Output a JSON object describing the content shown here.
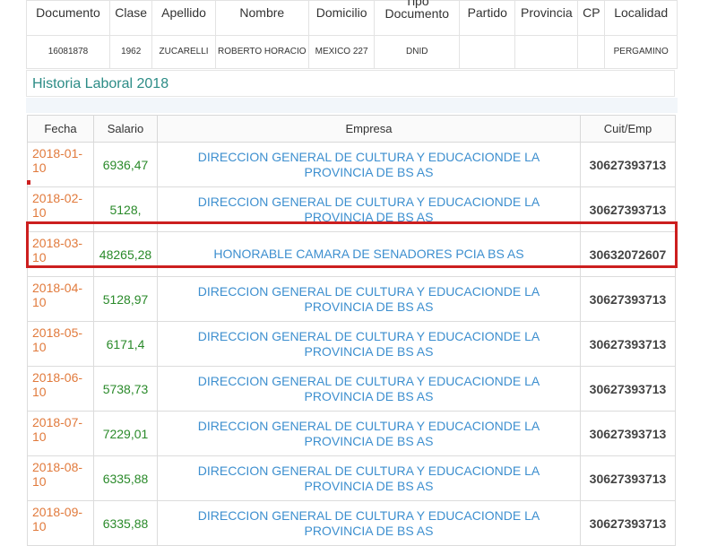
{
  "person_table": {
    "headers": [
      "Documento",
      "Clase",
      "Apellido",
      "Nombre",
      "Domicilio",
      "Tipo Documento",
      "Partido",
      "Provincia",
      "CP",
      "Localidad"
    ],
    "row": [
      "16081878",
      "1962",
      "ZUCARELLI",
      "ROBERTO HORACIO",
      "MEXICO 227",
      "DNID",
      "",
      "",
      "",
      "PERGAMINO"
    ]
  },
  "section": {
    "title": "Historia Laboral 2018"
  },
  "laboral_table": {
    "headers": {
      "fecha": "Fecha",
      "salario": "Salario",
      "empresa": "Empresa",
      "cuit": "Cuit/Emp"
    },
    "rows": [
      {
        "fecha": "2018-01-10",
        "salario": "6936,47",
        "empresa": "DIRECCION GENERAL DE CULTURA Y EDUCACIONDE LA PROVINCIA DE BS AS",
        "cuit": "30627393713"
      },
      {
        "fecha": "2018-02-10",
        "salario": "5128,",
        "empresa": "DIRECCION GENERAL DE CULTURA Y EDUCACIONDE LA PROVINCIA DE BS AS",
        "cuit": "30627393713"
      },
      {
        "fecha": "2018-03-10",
        "salario": "48265,28",
        "empresa": "HONORABLE CAMARA DE SENADORES PCIA BS AS",
        "cuit": "30632072607"
      },
      {
        "fecha": "2018-04-10",
        "salario": "5128,97",
        "empresa": "DIRECCION GENERAL DE CULTURA Y EDUCACIONDE LA PROVINCIA DE BS AS",
        "cuit": "30627393713"
      },
      {
        "fecha": "2018-05-10",
        "salario": "6171,4",
        "empresa": "DIRECCION GENERAL DE CULTURA Y EDUCACIONDE LA PROVINCIA DE BS AS",
        "cuit": "30627393713"
      },
      {
        "fecha": "2018-06-10",
        "salario": "5738,73",
        "empresa": "DIRECCION GENERAL DE CULTURA Y EDUCACIONDE LA PROVINCIA DE BS AS",
        "cuit": "30627393713"
      },
      {
        "fecha": "2018-07-10",
        "salario": "7229,01",
        "empresa": "DIRECCION GENERAL DE CULTURA Y EDUCACIONDE LA PROVINCIA DE BS AS",
        "cuit": "30627393713"
      },
      {
        "fecha": "2018-08-10",
        "salario": "6335,88",
        "empresa": "DIRECCION GENERAL DE CULTURA Y EDUCACIONDE LA PROVINCIA DE BS AS",
        "cuit": "30627393713"
      },
      {
        "fecha": "2018-09-10",
        "salario": "6335,88",
        "empresa": "DIRECCION GENERAL DE CULTURA Y EDUCACIONDE LA PROVINCIA DE BS AS",
        "cuit": "30627393713"
      }
    ]
  },
  "colors": {
    "fecha": "#e17a3c",
    "salario": "#2a8a2a",
    "empresa": "#3d8fcf",
    "section_title": "#2c8c86",
    "highlight_border": "#cc1f1f"
  }
}
